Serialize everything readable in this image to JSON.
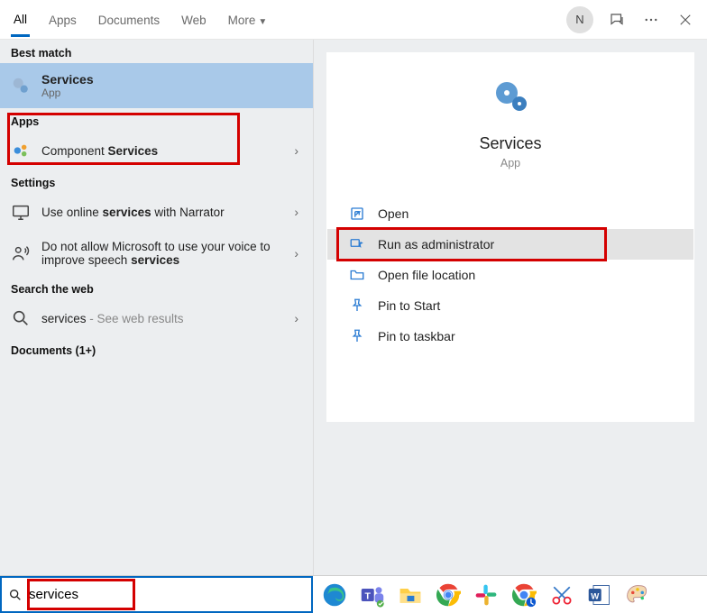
{
  "tabs": {
    "all": "All",
    "apps": "Apps",
    "documents": "Documents",
    "web": "Web",
    "more": "More"
  },
  "topbar": {
    "avatar_initial": "N"
  },
  "left": {
    "best_match_label": "Best match",
    "best": {
      "title": "Services",
      "sub": "App"
    },
    "apps_label": "Apps",
    "component_services_pre": "Component ",
    "component_services_bold": "Services",
    "settings_label": "Settings",
    "narrator_pre": "Use online ",
    "narrator_bold": "services",
    "narrator_post": " with Narrator",
    "speech_pre": "Do not allow Microsoft to use your voice to improve speech ",
    "speech_bold": "services",
    "search_web_label": "Search the web",
    "web_pre": "services",
    "web_post": " - See web results",
    "documents_label": "Documents (1+)"
  },
  "right": {
    "title": "Services",
    "sub": "App",
    "actions": {
      "open": "Open",
      "run_admin": "Run as administrator",
      "open_loc": "Open file location",
      "pin_start": "Pin to Start",
      "pin_taskbar": "Pin to taskbar"
    }
  },
  "search": {
    "value": "services"
  }
}
